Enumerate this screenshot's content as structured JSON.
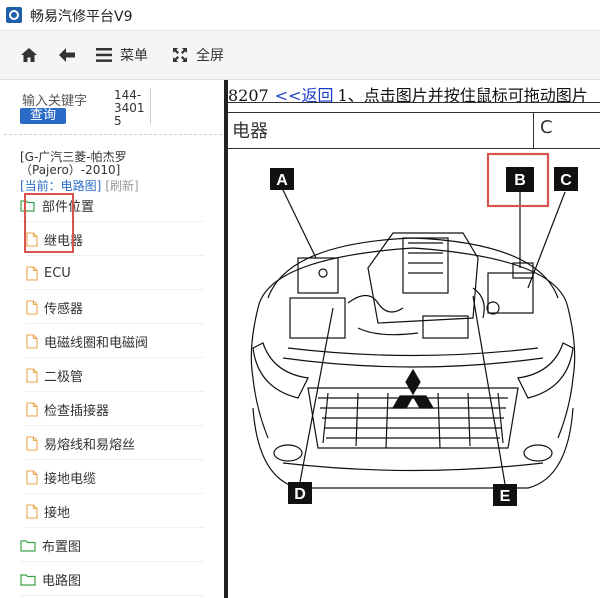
{
  "window": {
    "title": "畅易汽修平台V9"
  },
  "toolbar": {
    "menu_label": "菜单",
    "fullscreen_label": "全屏"
  },
  "sidebar": {
    "keyword_label": "输入关键字",
    "search_label": "查询",
    "code": "144-34015",
    "model": "[G-广汽三菱-帕杰罗",
    "model_line2": "（Pajero）-2010]",
    "current": "[当前：电路图]",
    "refresh": "[刷新]",
    "items": [
      {
        "label": "部件位置",
        "type": "folder-open"
      },
      {
        "label": "继电器",
        "type": "file"
      },
      {
        "label": "ECU",
        "type": "file"
      },
      {
        "label": "传感器",
        "type": "file"
      },
      {
        "label": "电磁线圈和电磁阀",
        "type": "file"
      },
      {
        "label": "二极管",
        "type": "file"
      },
      {
        "label": "检查插接器",
        "type": "file"
      },
      {
        "label": "易熔线和易熔丝",
        "type": "file"
      },
      {
        "label": "接地电缆",
        "type": "file"
      },
      {
        "label": "接地",
        "type": "file"
      },
      {
        "label": "布置图",
        "type": "folder"
      },
      {
        "label": "电路图",
        "type": "folder"
      }
    ]
  },
  "content": {
    "code_prefix": "8207",
    "back_link": "<<返回",
    "instruction": "1、点击图片并按住鼠标可拖动图片",
    "table_col1": "电器",
    "table_col2": "C",
    "callouts": [
      "A",
      "B",
      "C",
      "D",
      "E"
    ]
  },
  "colors": {
    "accent": "#2a6bc7",
    "highlight": "#d9534f",
    "link": "#1a3cc7"
  }
}
